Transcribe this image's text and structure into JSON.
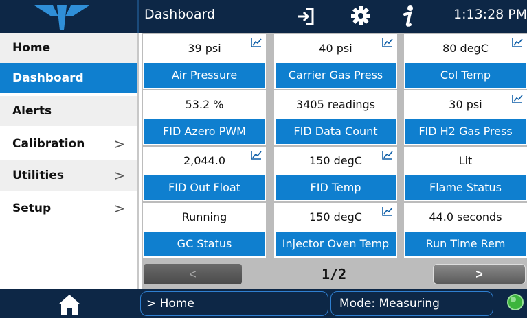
{
  "header": {
    "title": "Dashboard",
    "time": "1:13:28 PM"
  },
  "sidebar": {
    "items": [
      {
        "label": "Home"
      },
      {
        "label": "Dashboard"
      },
      {
        "label": "Alerts"
      },
      {
        "label": "Calibration",
        "chevron": ">"
      },
      {
        "label": "Utilities",
        "chevron": ">"
      },
      {
        "label": "Setup",
        "chevron": ">"
      }
    ]
  },
  "tiles": [
    {
      "value": "39 psi",
      "label": "Air Pressure",
      "trend": true
    },
    {
      "value": "40 psi",
      "label": "Carrier Gas Press",
      "trend": true
    },
    {
      "value": "80 degC",
      "label": "Col Temp",
      "trend": true
    },
    {
      "value": "53.2 %",
      "label": "FID Azero PWM",
      "trend": false
    },
    {
      "value": "3405 readings",
      "label": "FID Data Count",
      "trend": false
    },
    {
      "value": "30 psi",
      "label": "FID H2 Gas Press",
      "trend": true
    },
    {
      "value": "2,044.0",
      "label": "FID Out Float",
      "trend": true
    },
    {
      "value": "150 degC",
      "label": "FID Temp",
      "trend": true
    },
    {
      "value": "Lit",
      "label": "Flame Status",
      "trend": false
    },
    {
      "value": "Running",
      "label": "GC Status",
      "trend": false
    },
    {
      "value": "150 degC",
      "label": "Injector Oven Temp",
      "trend": true
    },
    {
      "value": "44.0 seconds",
      "label": "Run Time Rem",
      "trend": false
    }
  ],
  "pager": {
    "prev": "<",
    "next": ">",
    "page": "1/2"
  },
  "footer": {
    "breadcrumb": "> Home",
    "mode": "Mode: Measuring",
    "status_color": "#3cb43c"
  },
  "colors": {
    "accent": "#0f7fcf",
    "bar": "#0d2746"
  }
}
